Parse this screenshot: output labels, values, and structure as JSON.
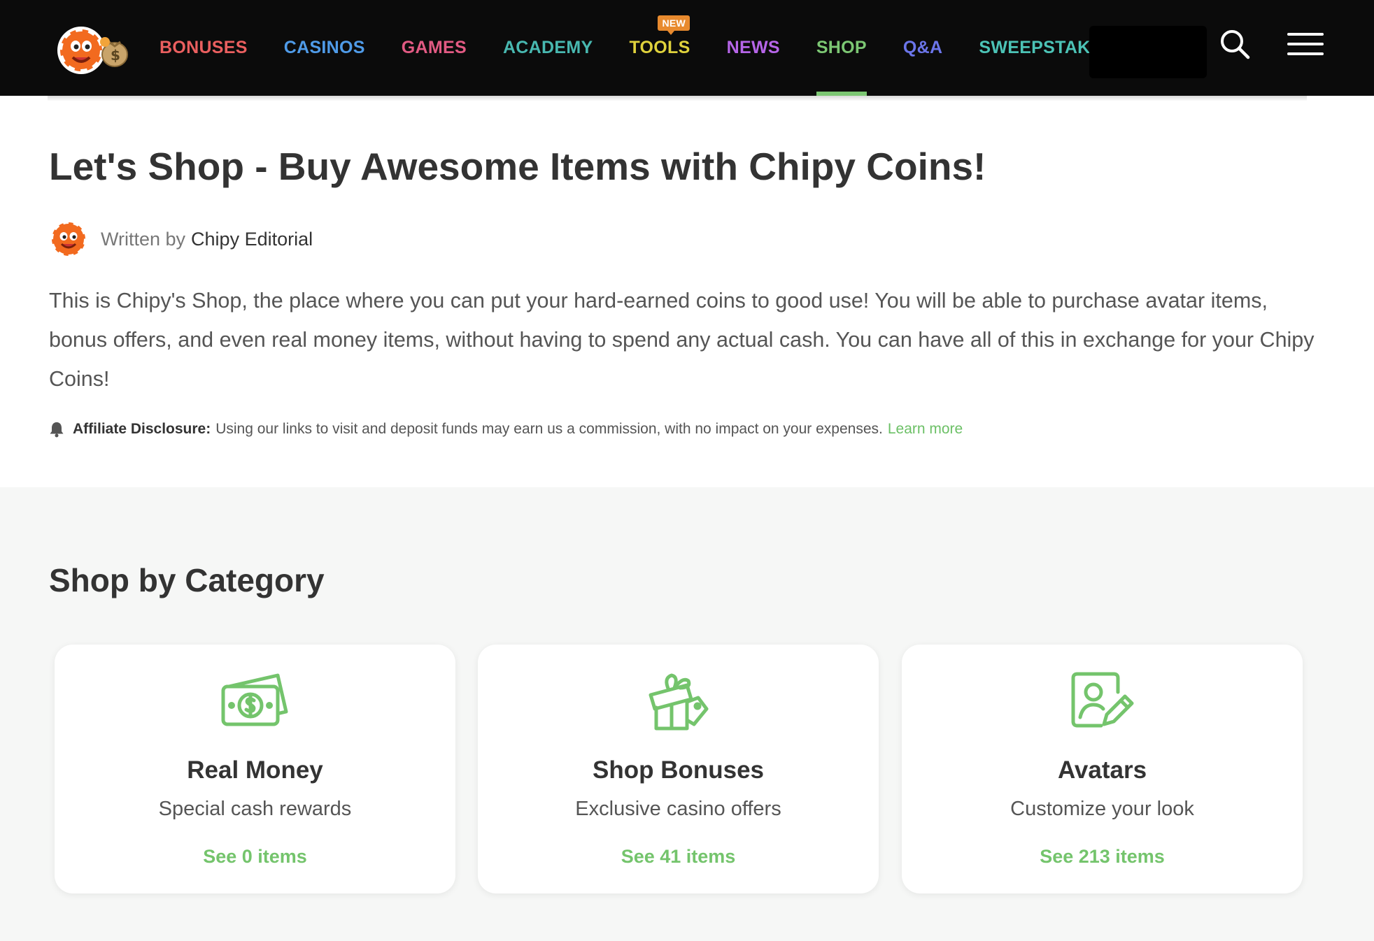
{
  "header": {
    "nav": [
      {
        "label": "BONUSES",
        "color": "#ea5f5f",
        "active": false
      },
      {
        "label": "CASINOS",
        "color": "#4f9be8",
        "active": false
      },
      {
        "label": "GAMES",
        "color": "#e25a83",
        "active": false
      },
      {
        "label": "ACADEMY",
        "color": "#48b8b0",
        "active": false
      },
      {
        "label": "TOOLS",
        "color": "#dfd23c",
        "active": false,
        "badge": "NEW"
      },
      {
        "label": "NEWS",
        "color": "#b665e8",
        "active": false
      },
      {
        "label": "SHOP",
        "color": "#7cc773",
        "active": true
      },
      {
        "label": "Q&A",
        "color": "#6b75ea",
        "active": false
      },
      {
        "label": "SWEEPSTAKES",
        "color": "#4cc3b6",
        "active": false
      }
    ],
    "icons": {
      "logo": "chipy-logo",
      "search": "search-icon",
      "menu": "hamburger-menu-icon"
    }
  },
  "page": {
    "title": "Let's Shop - Buy Awesome Items with Chipy Coins!",
    "author_prefix": "Written by",
    "author_name": "Chipy Editorial",
    "intro": "This is Chipy's Shop, the place where you can put your hard-earned coins to good use! You will be able to purchase avatar items, bonus offers, and even real money items, without having to spend any actual cash. You can have all of this in exchange for your Chipy Coins!",
    "disclosure_label": "Affiliate Disclosure:",
    "disclosure_text": "Using our links to visit and deposit funds may earn us a commission, with no impact on your expenses.",
    "disclosure_link": "Learn more"
  },
  "categories": {
    "title": "Shop by Category",
    "items": [
      {
        "icon": "money-icon",
        "title": "Real Money",
        "subtitle": "Special cash rewards",
        "link": "See 0 items"
      },
      {
        "icon": "gift-icon",
        "title": "Shop Bonuses",
        "subtitle": "Exclusive casino offers",
        "link": "See 41 items"
      },
      {
        "icon": "avatar-edit-icon",
        "title": "Avatars",
        "subtitle": "Customize your look",
        "link": "See 213 items"
      }
    ]
  },
  "colors": {
    "accent": "#7cc773",
    "header_bg": "#0b0b0b",
    "badge": "#e88a2e",
    "section_bg": "#f6f7f6"
  }
}
